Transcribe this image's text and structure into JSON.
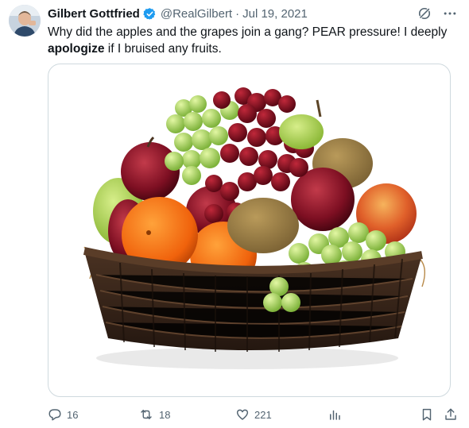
{
  "author": {
    "display_name": "Gilbert Gottfried",
    "handle": "@RealGilbert",
    "separator": "·",
    "date": "Jul 19, 2021"
  },
  "tweet": {
    "text_part1": "Why did the apples and the grapes join a gang? PEAR pressure! I deeply ",
    "text_bold": "apologize",
    "text_part2": " if I bruised any fruits."
  },
  "media": {
    "description_icon": "fruit-basket-photo"
  },
  "actions": {
    "replies": "16",
    "retweets": "18",
    "likes": "221"
  },
  "colors": {
    "verified_blue": "#1d9bf0",
    "secondary_text": "#536471"
  }
}
